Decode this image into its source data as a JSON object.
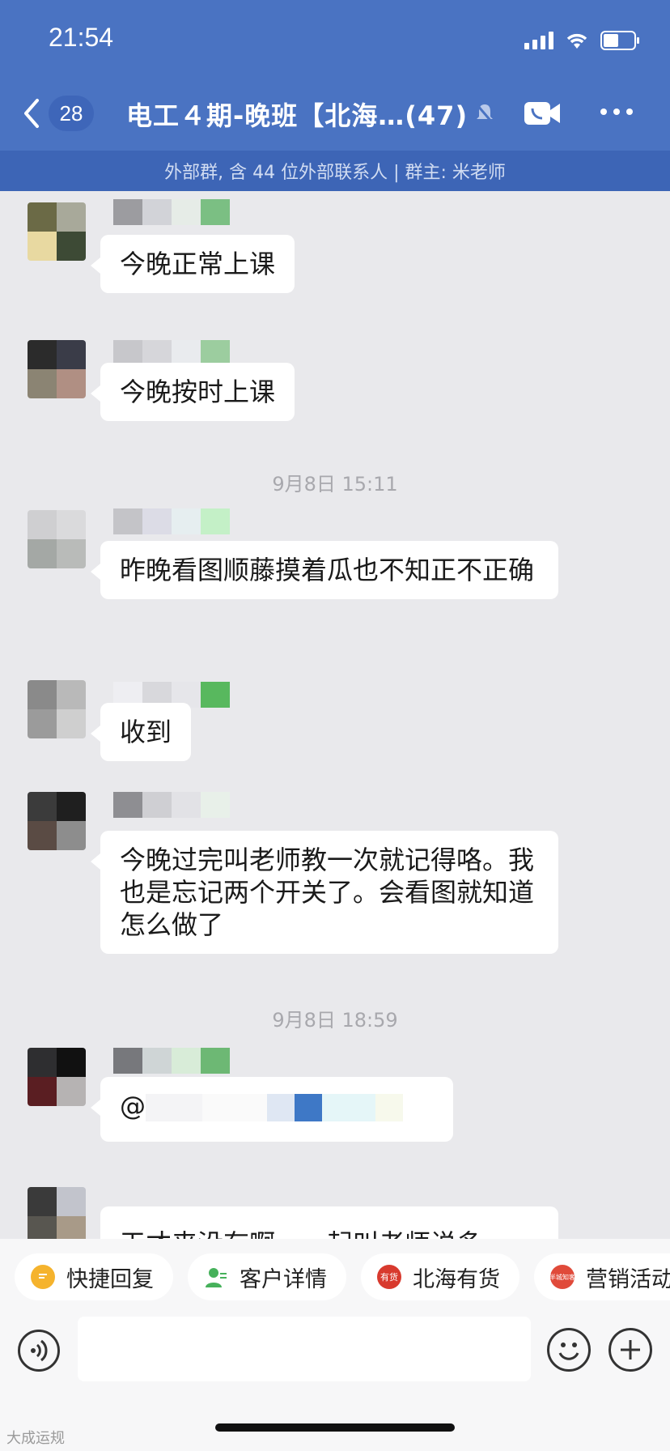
{
  "status_bar": {
    "time": "21:54"
  },
  "header": {
    "unread_count": "28",
    "title": "电工４期-晚班【北海…(47)",
    "subtitle": "外部群, 含 44 位外部联系人 | 群主: 米老师"
  },
  "messages": [
    {
      "text": "今晚正常上课"
    },
    {
      "text": "今晚按时上课"
    },
    {
      "text": "昨晚看图顺藤摸着瓜也不知正不正确"
    },
    {
      "text": "收到"
    },
    {
      "text": "今晚过完叫老师教一次就记得咯。我也是忘记两个开关了。会看图就知道怎么做了"
    },
    {
      "text": "@"
    },
    {
      "text": "天才来没有啊，一起叫老师说多一"
    }
  ],
  "timestamps": [
    "9月8日 15:11",
    "9月8日 18:59"
  ],
  "quick_actions": [
    {
      "label": "快捷回复",
      "icon": "quick-reply-icon",
      "color": "#f5b32d"
    },
    {
      "label": "客户详情",
      "icon": "customer-icon",
      "color": "#46b15b"
    },
    {
      "label": "北海有货",
      "icon": "store-icon",
      "color": "#d83a2e",
      "icon_text": "有货"
    },
    {
      "label": "营销活动",
      "icon": "marketing-icon",
      "color": "#e04a3a",
      "icon_text": "半城知客"
    }
  ],
  "watermark": "大成运规"
}
